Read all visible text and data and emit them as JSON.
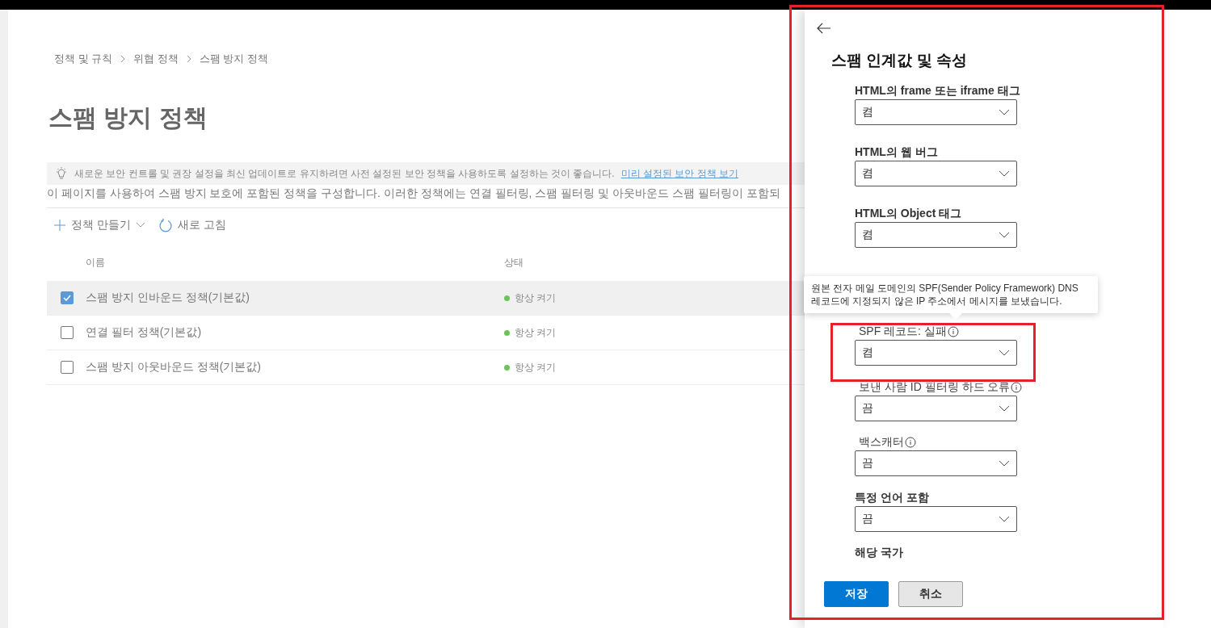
{
  "breadcrumb": [
    "정책 및 규칙",
    "위협 정책",
    "스팸 방지 정책"
  ],
  "title": "스팸 방지 정책",
  "banner": {
    "text": "새로운 보안 컨트롤 및 권장 설정을 최신 업데이트로 유지하려면 사전 설정된 보안 정책을 사용하도록 설정하는 것이 좋습니다.",
    "link": "미리 설정된 보안 정책 보기"
  },
  "description": "이 페이지를 사용하여 스팸 방지 보호에 포함된 정책을 구성합니다. 이러한 정책에는 연결 필터링, 스팸 필터링 및 아웃바운드 스팸 필터링이 포함되",
  "toolbar": {
    "create": "정책 만들기",
    "refresh": "새로 고침"
  },
  "table": {
    "columns": [
      "이름",
      "상태"
    ],
    "rows": [
      {
        "name": "스팸 방지 인바운드 정책(기본값)",
        "status": "항상 켜기",
        "selected": true
      },
      {
        "name": "연결 필터 정책(기본값)",
        "status": "항상 켜기",
        "selected": false
      },
      {
        "name": "스팸 방지 아웃바운드 정책(기본값)",
        "status": "항상 켜기",
        "selected": false
      }
    ]
  },
  "panel": {
    "title": "스팸 인계값 및 속성",
    "fields": [
      {
        "label": "HTML의 frame 또는 iframe 태그",
        "info": false,
        "value": "켬"
      },
      {
        "label": "HTML의 웹 버그",
        "info": false,
        "value": "켬"
      },
      {
        "label": "HTML의 Object 태그",
        "info": false,
        "value": "켬"
      },
      {
        "label": "SPF 레코드: 실패",
        "info": true,
        "value": "켬"
      },
      {
        "label": "보낸 사람 ID 필터링 하드 오류",
        "info": true,
        "value": "끔"
      },
      {
        "label": "백스캐터",
        "info": true,
        "value": "끔"
      },
      {
        "label": "특정 언어 포함",
        "info": false,
        "value": "끔"
      },
      {
        "label": "해당 국가",
        "info": false
      }
    ],
    "tooltip": "원본 전자 메일 도메인의 SPF(Sender Policy Framework) DNS 레코드에 지정되지 않은 IP 주소에서 메시지를 보냈습니다.",
    "buttons": [
      "저장",
      "취소"
    ]
  }
}
